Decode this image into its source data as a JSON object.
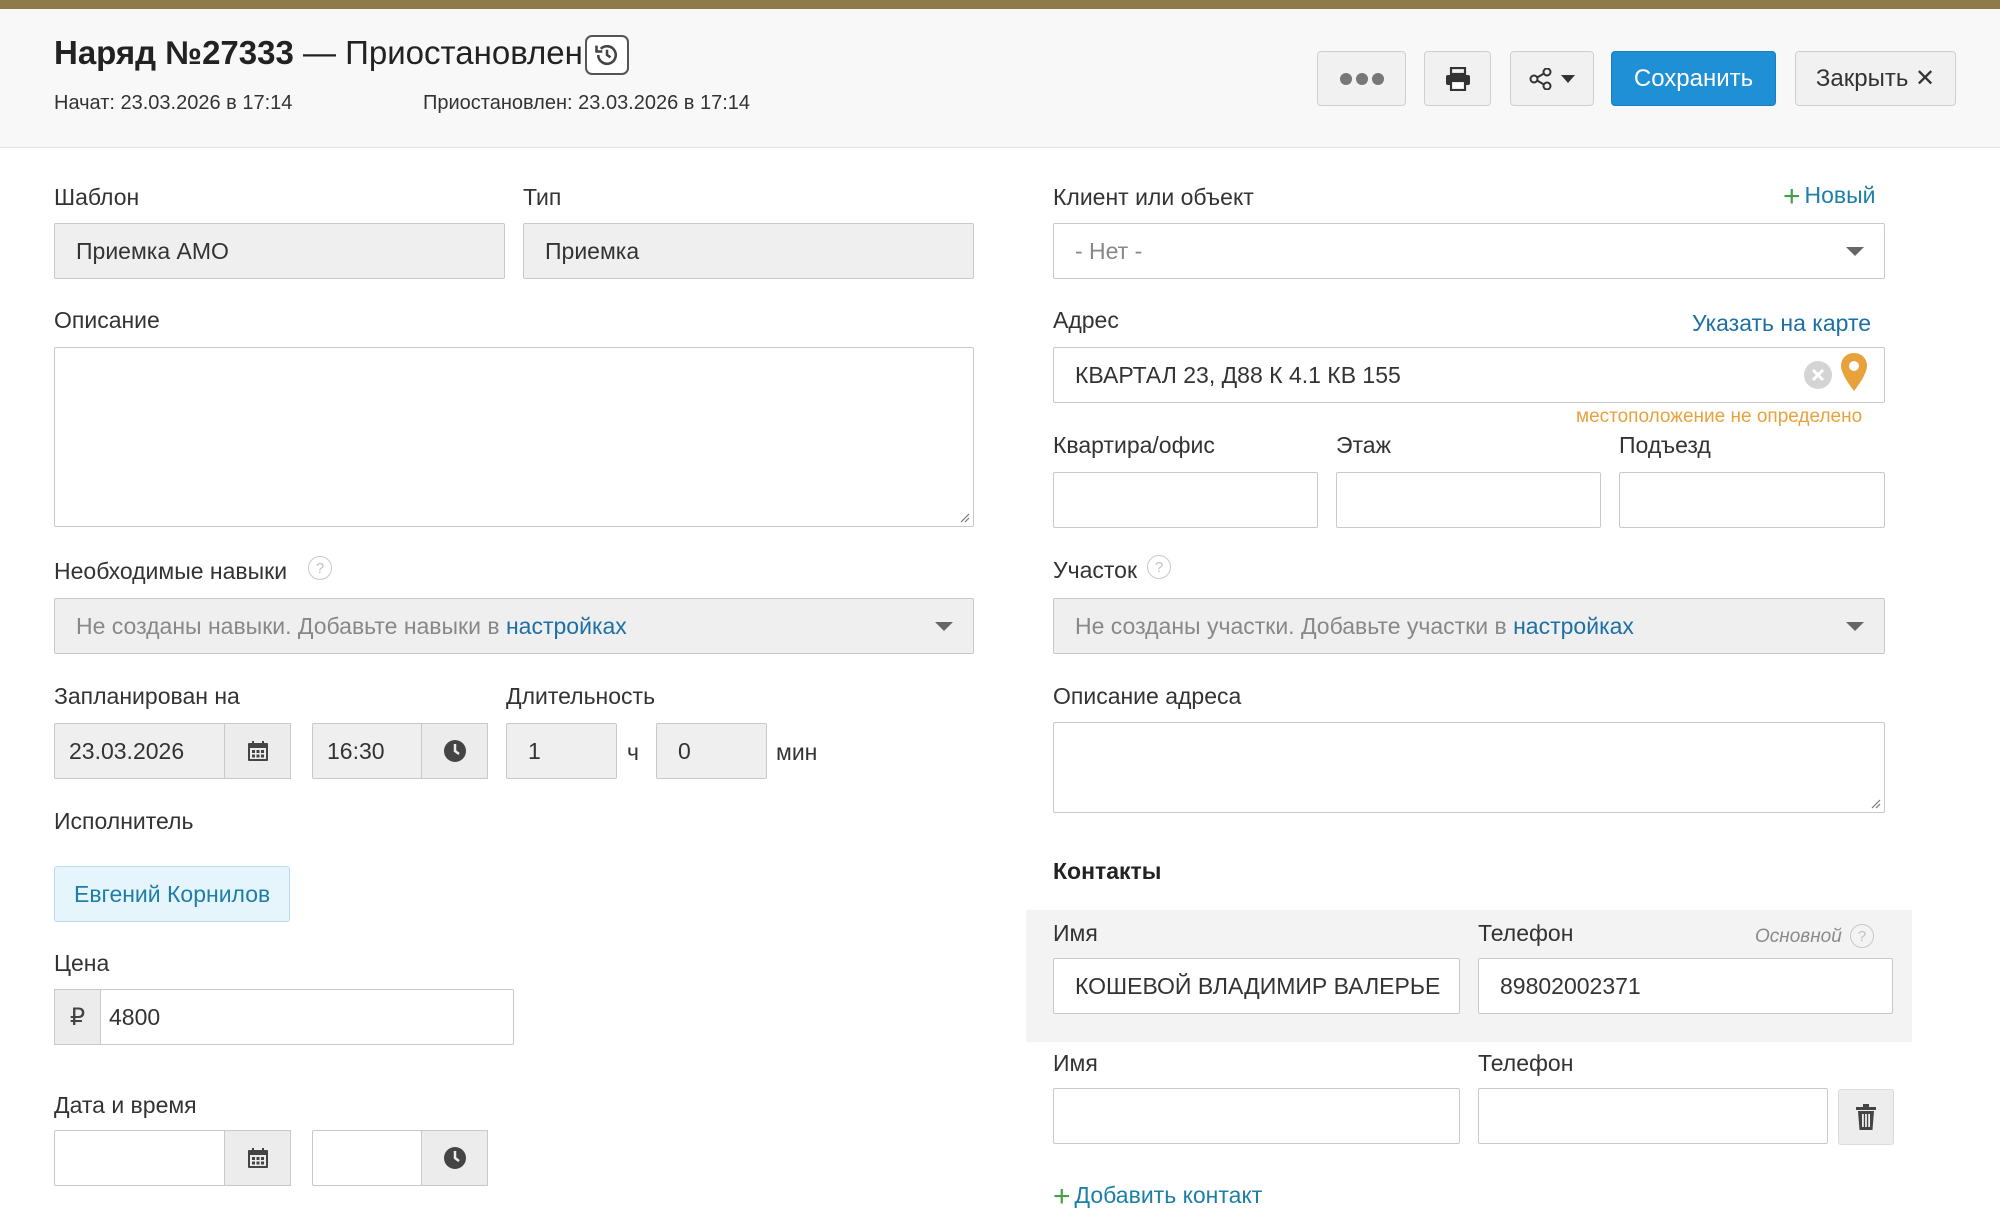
{
  "header": {
    "title_prefix": "Наряд №27333",
    "title_status": " — Приостановлен",
    "started": "Начат: 23.03.2026 в 17:14",
    "suspended": "Приостановлен: 23.03.2026 в 17:14",
    "save_label": "Сохранить",
    "close_label": "Закрыть ✕"
  },
  "left": {
    "template_label": "Шаблон",
    "template_value": "Приемка АМО",
    "type_label": "Тип",
    "type_value": "Приемка",
    "description_label": "Описание",
    "skills_label": "Необходимые навыки",
    "skills_placeholder": "Не созданы навыки. Добавьте навыки в ",
    "skills_link": "настройках",
    "scheduled_label": "Запланирован на",
    "scheduled_date": "23.03.2026",
    "scheduled_time": "16:30",
    "duration_label": "Длительность",
    "duration_hours": "1",
    "hours_unit": "ч",
    "duration_minutes": "0",
    "minutes_unit": "мин",
    "executor_label": "Исполнитель",
    "executor_name": "Евгений Корнилов",
    "price_label": "Цена",
    "currency_symbol": "₽",
    "price_value": "4800",
    "datetime_label": "Дата и время"
  },
  "right": {
    "client_label": "Клиент или объект",
    "new_link": "Новый",
    "client_value": "- Нет -",
    "address_label": "Адрес",
    "map_link": "Указать на карте",
    "address_value": "КВАРТАЛ 23, Д88 К 4.1 КВ 155",
    "location_warning": "местоположение не определено",
    "apartment_label": "Квартира/офис",
    "floor_label": "Этаж",
    "entrance_label": "Подъезд",
    "district_label": "Участок",
    "district_placeholder": "Не созданы участки. Добавьте участки в ",
    "district_link": "настройках",
    "address_desc_label": "Описание адреса",
    "contacts_heading": "Контакты",
    "contact1": {
      "name_label": "Имя",
      "phone_label": "Телефон",
      "primary_label": "Основной",
      "name_value": "КОШЕВОЙ ВЛАДИМИР ВАЛЕРЬЕ",
      "phone_value": "89802002371"
    },
    "contact2": {
      "name_label": "Имя",
      "phone_label": "Телефон"
    },
    "add_contact": "Добавить контакт"
  },
  "colors": {
    "primary": "#1f8fd6",
    "link": "#1d6fa5",
    "warning": "#e8a23b",
    "add_plus": "#43a047"
  }
}
